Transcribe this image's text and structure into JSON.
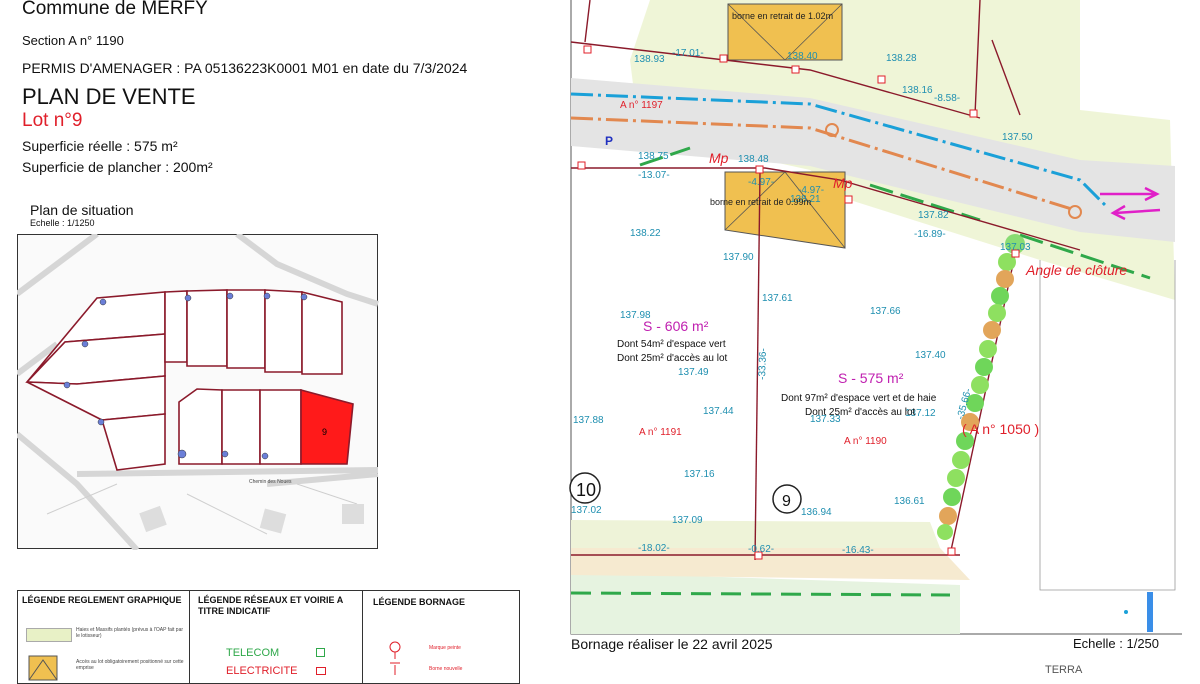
{
  "header": {
    "commune": "Commune de MERFY",
    "section": "Section A n° 1190",
    "permis": "PERMIS D'AMENAGER : PA 05136223K0001 M01 en date du 7/3/2024",
    "plan_title": "PLAN DE VENTE",
    "lot": "Lot n°9",
    "superficie_reelle": "Superficie réelle : 575 m²",
    "superficie_plancher": "Superficie de plancher :  200m²"
  },
  "situation": {
    "title": "Plan de situation",
    "scale": "Echelle : 1/1250",
    "highlight_lot": "9",
    "street": "Chemin des Noues"
  },
  "legend": {
    "col1_title": "LÉGENDE REGLEMENT GRAPHIQUE",
    "col1_item1": "Haies et Massifs plantés (prévus à l'OAP fait par le lotisseur)",
    "col1_item2": "Accès au lot obligatoirement positionné sur cette emprise",
    "col2_title": "LÉGENDE RÉSEAUX ET VOIRIE A TITRE INDICATIF",
    "telecom": "TELECOM",
    "electricite": "ELECTRICITE",
    "col3_title": "LÉGENDE BORNAGE",
    "borne1": "Marque peinte",
    "borne2": "Borne nouvelle"
  },
  "plan": {
    "borne_top": "borne en retrait de 1.02m",
    "borne_bottom": "borne en retrait de 0.99m",
    "parcel_1197": "A n° 1197",
    "parcel_1191": "A n° 1191",
    "parcel_1190": "A n° 1190",
    "parcel_1050": "( A n° 1050 )",
    "angle": "Angle de clôture",
    "lot10_area": "S - 606 m²",
    "lot10_d1": "Dont 54m² d'espace vert",
    "lot10_d2": "Dont 25m² d'accès au lot",
    "lot9_area": "S - 575 m²",
    "lot9_d1": "Dont 97m² d'espace vert et de haie",
    "lot9_d2": "Dont 25m² d'accès au lot",
    "lot10_no": "10",
    "lot9_no": "9",
    "mp1": "Mp",
    "mp2": "Mp",
    "p": "P",
    "levels": {
      "l1": "138.93",
      "l2": "-17.01-",
      "l3": "138.40",
      "l4": "138.28",
      "l5": "138.16",
      "l6": "-8.58-",
      "l7": "137.50",
      "l8": "138.75",
      "l9": "-13.07-",
      "l10": "138.48",
      "l11": "-4.97-",
      "l12": "-4.97-",
      "l13": "138.21",
      "l14": "137.82",
      "l15": "-16.89-",
      "l16": "138.22",
      "l17": "137.90",
      "l18": "137.61",
      "l19": "137.66",
      "l20": "137.98",
      "l21": "137.49",
      "l22": "137.40",
      "l23": "137.44",
      "l24": "137.33",
      "l25": "137.12",
      "l26": "137.88",
      "l27": "137.16",
      "l28": "136.61",
      "l29": "137.02",
      "l30": "137.09",
      "l31": "136.94",
      "l32": "-18.02-",
      "l33": "-0.62-",
      "l34": "-16.43-",
      "l35": "-33.36-",
      "l36": "-35.66-",
      "l37": "137.03"
    }
  },
  "footer": {
    "bornage": "Bornage réaliser le 22 avril 2025",
    "echelle": "Echelle : 1/250",
    "terra": "TERRA"
  },
  "colors": {
    "red": "#e01f2a",
    "parcel_line": "#8b1a2b",
    "cyan": "#1aa0d8",
    "orange": "#e2884f",
    "green": "#2fa84a",
    "magenta": "#e020c8",
    "road": "#e4e4e4",
    "grass": "#e8f1c6",
    "access": "#f0c050"
  }
}
